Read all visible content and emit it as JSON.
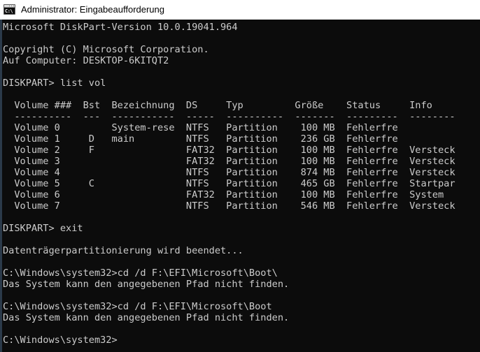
{
  "window": {
    "title": "Administrator: Eingabeaufforderung",
    "icon": "cmd-console-icon",
    "icon_glyph": "C:\\",
    "titlebar_bg": "#ffffff",
    "titlebar_fg": "#000000",
    "console_bg": "#0c0c0c",
    "console_fg": "#cccccc",
    "left_edge_color": "#2b3a4a"
  },
  "console": {
    "lines": [
      "Microsoft DiskPart-Version 10.0.19041.964",
      "",
      "Copyright (C) Microsoft Corporation.",
      "Auf Computer: DESKTOP-6KITQT2",
      "",
      "DISKPART> list vol",
      "",
      "  Volume ###  Bst  Bezeichnung  DS     Typ         Größe    Status     Info",
      "  ----------  ---  -----------  -----  ----------  -------  ---------  --------",
      "  Volume 0         System-rese  NTFS   Partition    100 MB  Fehlerfre",
      "  Volume 1     D   main         NTFS   Partition    236 GB  Fehlerfre",
      "  Volume 2     F                FAT32  Partition    100 MB  Fehlerfre  Versteck",
      "  Volume 3                      FAT32  Partition    100 MB  Fehlerfre  Versteck",
      "  Volume 4                      NTFS   Partition    874 MB  Fehlerfre  Versteck",
      "  Volume 5     C                NTFS   Partition    465 GB  Fehlerfre  Startpar",
      "  Volume 6                      FAT32  Partition    100 MB  Fehlerfre  System",
      "  Volume 7                      NTFS   Partition    546 MB  Fehlerfre  Versteck",
      "",
      "DISKPART> exit",
      "",
      "Datenträgerpartitionierung wird beendet...",
      "",
      "C:\\Windows\\system32>cd /d F:\\EFI\\Microsoft\\Boot\\",
      "Das System kann den angegebenen Pfad nicht finden.",
      "",
      "C:\\Windows\\system32>cd /d F:\\EFI\\Microsoft\\Boot",
      "Das System kann den angegebenen Pfad nicht finden.",
      "",
      "C:\\Windows\\system32>"
    ],
    "diskpart_table": {
      "headers": [
        "Volume ###",
        "Bst",
        "Bezeichnung",
        "DS",
        "Typ",
        "Größe",
        "Status",
        "Info"
      ],
      "rows": [
        {
          "volume": "Volume 0",
          "bst": "",
          "bezeichnung": "System-rese",
          "ds": "NTFS",
          "typ": "Partition",
          "groesse": "100 MB",
          "status": "Fehlerfre",
          "info": ""
        },
        {
          "volume": "Volume 1",
          "bst": "D",
          "bezeichnung": "main",
          "ds": "NTFS",
          "typ": "Partition",
          "groesse": "236 GB",
          "status": "Fehlerfre",
          "info": ""
        },
        {
          "volume": "Volume 2",
          "bst": "F",
          "bezeichnung": "",
          "ds": "FAT32",
          "typ": "Partition",
          "groesse": "100 MB",
          "status": "Fehlerfre",
          "info": "Versteck"
        },
        {
          "volume": "Volume 3",
          "bst": "",
          "bezeichnung": "",
          "ds": "FAT32",
          "typ": "Partition",
          "groesse": "100 MB",
          "status": "Fehlerfre",
          "info": "Versteck"
        },
        {
          "volume": "Volume 4",
          "bst": "",
          "bezeichnung": "",
          "ds": "NTFS",
          "typ": "Partition",
          "groesse": "874 MB",
          "status": "Fehlerfre",
          "info": "Versteck"
        },
        {
          "volume": "Volume 5",
          "bst": "C",
          "bezeichnung": "",
          "ds": "NTFS",
          "typ": "Partition",
          "groesse": "465 GB",
          "status": "Fehlerfre",
          "info": "Startpar"
        },
        {
          "volume": "Volume 6",
          "bst": "",
          "bezeichnung": "",
          "ds": "FAT32",
          "typ": "Partition",
          "groesse": "100 MB",
          "status": "Fehlerfre",
          "info": "System"
        },
        {
          "volume": "Volume 7",
          "bst": "",
          "bezeichnung": "",
          "ds": "NTFS",
          "typ": "Partition",
          "groesse": "546 MB",
          "status": "Fehlerfre",
          "info": "Versteck"
        }
      ]
    },
    "commands": [
      {
        "prompt": "DISKPART> ",
        "command": "list vol"
      },
      {
        "prompt": "DISKPART> ",
        "command": "exit"
      },
      {
        "prompt": "C:\\Windows\\system32>",
        "command": "cd /d F:\\EFI\\Microsoft\\Boot\\"
      },
      {
        "prompt": "C:\\Windows\\system32>",
        "command": "cd /d F:\\EFI\\Microsoft\\Boot"
      },
      {
        "prompt": "C:\\Windows\\system32>",
        "command": ""
      }
    ],
    "messages": [
      "Datenträgerpartitionierung wird beendet...",
      "Das System kann den angegebenen Pfad nicht finden."
    ]
  }
}
